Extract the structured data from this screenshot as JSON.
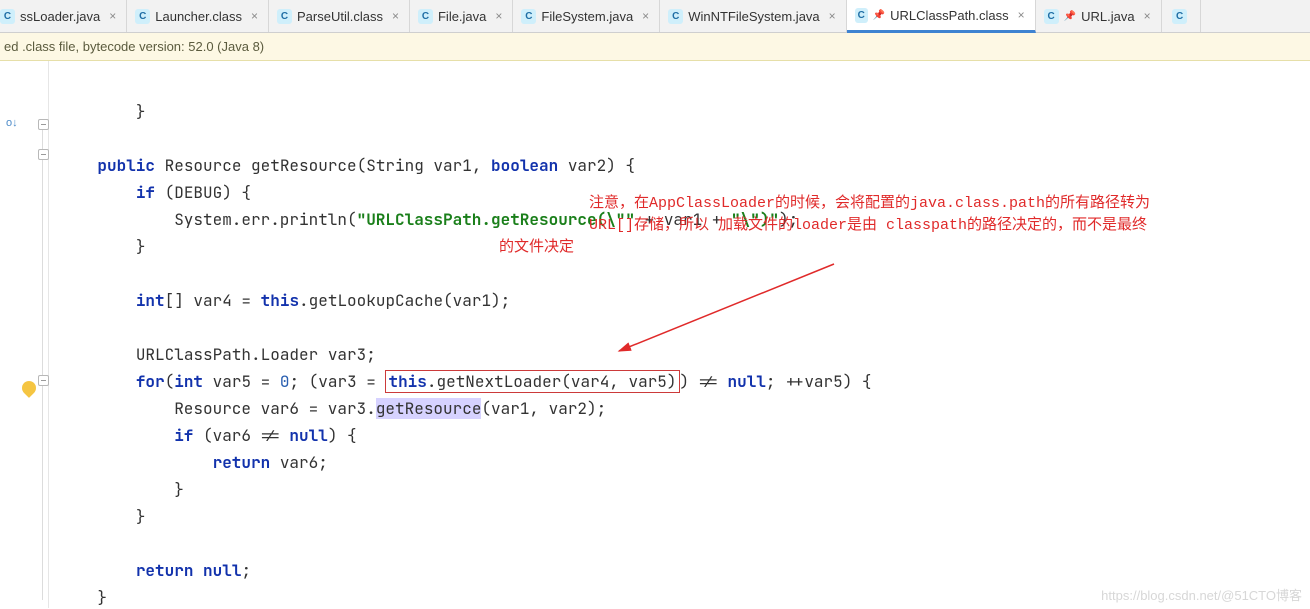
{
  "tabs": [
    {
      "label": "ssLoader.java",
      "icon": "C",
      "close": true,
      "partial": true
    },
    {
      "label": "Launcher.class",
      "icon": "C",
      "close": true
    },
    {
      "label": "ParseUtil.class",
      "icon": "C",
      "close": true
    },
    {
      "label": "File.java",
      "icon": "C",
      "close": true
    },
    {
      "label": "FileSystem.java",
      "icon": "C",
      "close": true
    },
    {
      "label": "WinNTFileSystem.java",
      "icon": "C",
      "close": true
    },
    {
      "label": "URLClassPath.class",
      "icon": "C",
      "close": true,
      "pin": true,
      "active": true
    },
    {
      "label": "URL.java",
      "icon": "C",
      "close": true,
      "pin": true
    },
    {
      "label": "",
      "icon": "C",
      "close": false,
      "extra": true
    }
  ],
  "banner": "ed .class file, bytecode version: 52.0 (Java 8)",
  "code": {
    "brace_top": "}",
    "sig_pre": "public",
    "sig_ret": " Resource getResource(String var1, ",
    "sig_bool": "boolean",
    "sig_post": " var2) {",
    "if_kw": "if",
    "if_cond": " (DEBUG) {",
    "println_pre": "System.err.println(",
    "println_s1": "\"URLClassPath.getResource(\\\"\"",
    "println_mid": " + var1 + ",
    "println_s2": "\"\\\")\"",
    "println_post": ");",
    "close1": "}",
    "int_kw": "int",
    "arr_decl": "[] var4 = ",
    "this_kw": "this",
    "lookup": ".getLookupCache(var1);",
    "loader_decl": "URLClassPath.Loader var3;",
    "for_kw": "for",
    "for_open": "(",
    "for_int": "int",
    "for_init": " var5 = ",
    "zero": "0",
    "for_cond1": "; (var3 = ",
    "boxed_this": "this",
    "boxed_call": ".getNextLoader(var4, var5)",
    "for_cond2": ") != ",
    "null_kw": "null",
    "for_iter": "; ++var5) {",
    "res_line_pre": "Resource var6 = var3.",
    "res_sel": "getResource",
    "res_line_post": "(var1, var2);",
    "if2_kw": "if",
    "if2_cond": " (var6 != ",
    "if2_post": ") {",
    "return_kw": "return",
    "return_post": " var6;",
    "close2": "}",
    "close3": "}",
    "return2_kw": "return",
    "return2_post": " ",
    "semicolon": ";",
    "close4": "}"
  },
  "annotation": {
    "line1": "注意，在AppClassLoader的时候，会将配置的java.class.path的所有路径转为",
    "line2": "URL[]存储，所以 加载文件的loader是由 classpath的路径决定的，而不是最终",
    "line3": "的文件决定"
  },
  "watermark": "https://blog.csdn.net/@51CTO博客",
  "colors": {
    "annotation": "#e02a2a",
    "tab_active_underline": "#3e83d1",
    "banner_bg": "#fdf8e4"
  }
}
